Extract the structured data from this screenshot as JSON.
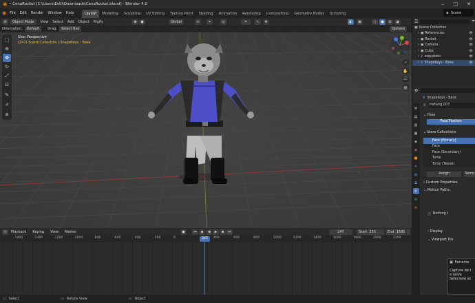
{
  "window": {
    "title": "• CenaRocket [C:\\Users\\Estil\\Downloads\\CenaRocket.blend] - Blender 4.0"
  },
  "menu": {
    "items": [
      "File",
      "Edit",
      "Render",
      "Window",
      "Help"
    ],
    "workspaces": [
      {
        "label": "Layout",
        "active": true
      },
      {
        "label": "Modeling"
      },
      {
        "label": "Sculpting"
      },
      {
        "label": "UV Editing"
      },
      {
        "label": "Texture Paint"
      },
      {
        "label": "Shading"
      },
      {
        "label": "Animation"
      },
      {
        "label": "Rendering"
      },
      {
        "label": "Compositing"
      },
      {
        "label": "Geometry Nodes"
      },
      {
        "label": "Scripting"
      }
    ],
    "scene": "Scene"
  },
  "viewport_header": {
    "mode": "Object Mode",
    "menus": [
      "View",
      "Select",
      "Add",
      "Object",
      "Rigify"
    ],
    "transform": "Global"
  },
  "tool_header": {
    "orientation_label": "Orientation:",
    "orientation": "Default",
    "drag_label": "Drag:",
    "drag": "Select Box",
    "options": "Options"
  },
  "viewport": {
    "view_name": "User Perspective",
    "collection_info": "(247) Scene Collection | Shapekeys - Base"
  },
  "timeline": {
    "menus": [
      "Playback",
      "Keying",
      "View",
      "Marker"
    ],
    "current_frame": "247",
    "start_label": "Start",
    "start": "253",
    "end_label": "End",
    "end": "1681",
    "ticks": [
      "-1400",
      "-1400",
      "-1200",
      "-1000",
      "-800",
      "-600",
      "-400",
      "-200",
      "0",
      "",
      "400",
      "600",
      "800",
      "1000",
      "1200",
      "1400",
      "1600",
      "1800",
      "2000",
      "2200"
    ],
    "playhead": "247"
  },
  "status": {
    "select": "Select",
    "rotate": "Rotate View",
    "object": "Object"
  },
  "outliner": {
    "root": "Scene Collection",
    "items": [
      {
        "label": "Referencias"
      },
      {
        "label": "Rocket"
      },
      {
        "label": "Camera"
      },
      {
        "label": "Cube"
      },
      {
        "label": "esqueleto"
      },
      {
        "label": "Shapekeys - Base",
        "selected": true
      }
    ]
  },
  "properties": {
    "object": "Shapekeys - Base",
    "data": "metarig.003",
    "pose_section": "Pose",
    "pose_position": "Pose Position",
    "bone_collections": "Bone Collections",
    "collections": [
      {
        "label": "Face (Primary)",
        "selected": true
      },
      {
        "label": "Face"
      },
      {
        "label": "Face (Secondary)"
      },
      {
        "label": "Torso"
      },
      {
        "label": "Torso (Tweak)"
      }
    ],
    "assign": "Assign",
    "remove": "Remo",
    "custom_props": "Custom Properties",
    "motion_paths": "Motion Paths",
    "display": "Display",
    "viewport_display": "Viewport Dis",
    "nothing": "Nothing t"
  },
  "notification": {
    "title": "Ferrame",
    "line1": "Captura de t",
    "line2": "e salva",
    "line3": "Selecione ac"
  },
  "colors": {
    "accent": "#4772b3",
    "background": "#3d3d3d",
    "header": "#2a2a2a"
  }
}
